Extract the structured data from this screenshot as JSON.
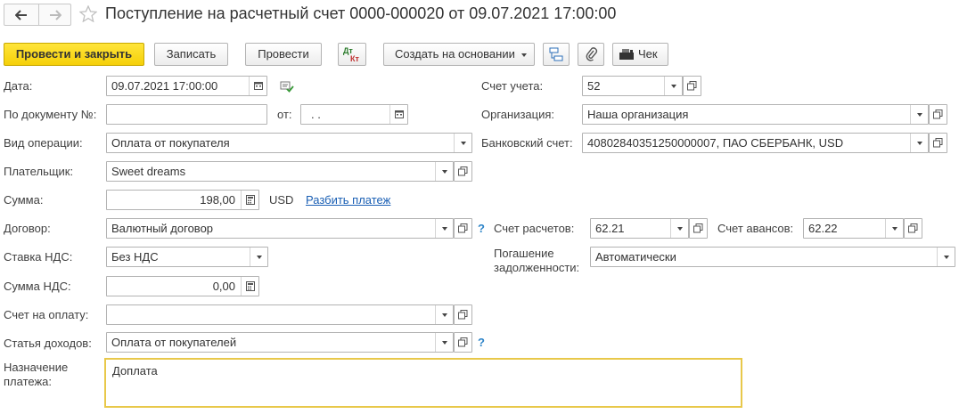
{
  "header": {
    "title": "Поступление на расчетный счет 0000-000020 от 09.07.2021 17:00:00"
  },
  "toolbar": {
    "post_close": "Провести и закрыть",
    "save": "Записать",
    "post": "Провести",
    "dtkt_top": "Дт",
    "dtkt_bottom": "Кт",
    "create_based": "Создать на основании",
    "receipt": "Чек"
  },
  "form": {
    "date_label": "Дата:",
    "date_value": "09.07.2021 17:00:00",
    "doc_no_label": "По документу №:",
    "doc_no_value": "",
    "from_label": "от:",
    "from_value": " .  .",
    "op_type_label": "Вид операции:",
    "op_type_value": "Оплата от покупателя",
    "payer_label": "Плательщик:",
    "payer_value": "Sweet dreams",
    "amount_label": "Сумма:",
    "amount_value": "198,00",
    "currency": "USD",
    "split_link": "Разбить платеж",
    "contract_label": "Договор:",
    "contract_value": "Валютный договор",
    "vat_rate_label": "Ставка НДС:",
    "vat_rate_value": "Без НДС",
    "vat_amount_label": "Сумма НДС:",
    "vat_amount_value": "0,00",
    "invoice_label": "Счет на оплату:",
    "invoice_value": "",
    "income_item_label": "Статья доходов:",
    "income_item_value": "Оплата от покупателей",
    "purpose_label_1": "Назначение",
    "purpose_label_2": "платежа:",
    "purpose_value": "Доплата",
    "account_label": "Счет учета:",
    "account_value": "52",
    "org_label": "Организация:",
    "org_value": "Наша организация",
    "bank_label": "Банковский счет:",
    "bank_value": "40802840351250000007, ПАО СБЕРБАНК, USD",
    "settle_label": "Счет расчетов:",
    "settle_value": "62.21",
    "advance_label": "Счет авансов:",
    "advance_value": "62.22",
    "repay_label_1": "Погашение",
    "repay_label_2": "задолженности:",
    "repay_value": "Автоматически",
    "help": "?"
  },
  "colors": {
    "primary_button": "#f5d009",
    "link": "#1a5fb4",
    "help": "#2d84c8",
    "focus_border": "#e8c84a"
  },
  "icons": {
    "back": "arrow-left-icon",
    "forward": "arrow-right-icon",
    "favorite": "star-icon",
    "calendar": "calendar-icon",
    "calculator": "calculator-icon",
    "open": "open-form-icon",
    "structure": "structure-icon",
    "attach": "paperclip-icon",
    "receipt": "cash-register-icon"
  }
}
